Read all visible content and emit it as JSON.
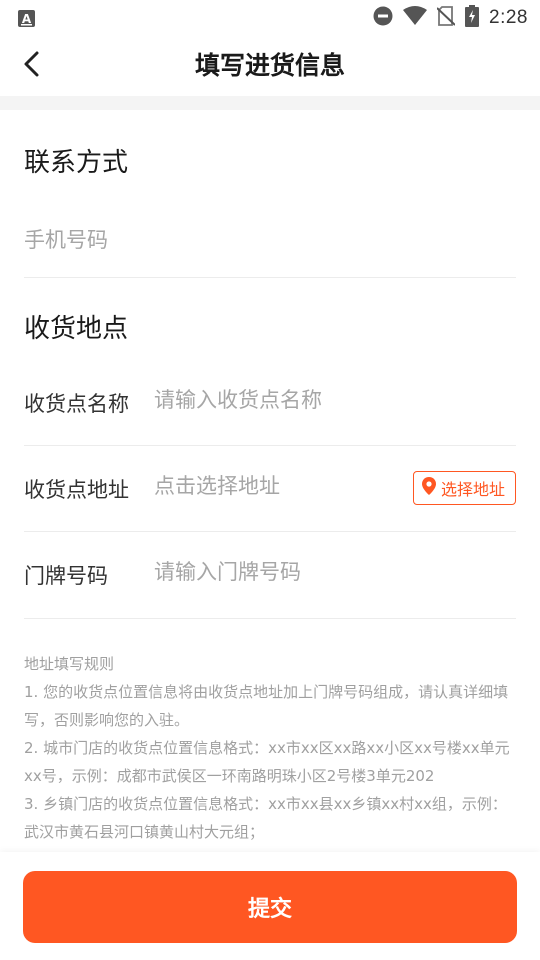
{
  "status_bar": {
    "left_icon": "a-letter-icon",
    "icons": [
      "do-not-disturb-icon",
      "wifi-icon",
      "no-sim-icon",
      "battery-charging-icon"
    ],
    "time": "2:28"
  },
  "header": {
    "back_icon": "chevron-left-icon",
    "title": "填写进货信息"
  },
  "contact_section": {
    "title": "联系方式",
    "phone_placeholder": "手机号码"
  },
  "location_section": {
    "title": "收货地点",
    "name_label": "收货点名称",
    "name_placeholder": "请输入收货点名称",
    "address_label": "收货点地址",
    "address_placeholder": "点击选择地址",
    "select_address_label": "选择地址",
    "select_address_icon": "location-pin-icon",
    "door_label": "门牌号码",
    "door_placeholder": "请输入门牌号码"
  },
  "rules": {
    "title": "地址填写规则",
    "line1": "1. 您的收货点位置信息将由收货点地址加上门牌号码组成，请认真详细填写，否则影响您的入驻。",
    "line2": "2. 城市门店的收货点位置信息格式：xx市xx区xx路xx小区xx号楼xx单元xx号，示例：成都市武侯区一环南路明珠小区2号楼3单元202",
    "line3": "3. 乡镇门店的收货点位置信息格式：xx市xx县xx乡镇xx村xx组，示例：武汉市黄石县河口镇黄山村大元组；"
  },
  "footer": {
    "submit_label": "提交"
  },
  "colors": {
    "accent": "#ff5722",
    "placeholder": "#a6a6a6",
    "divider": "#ececec"
  }
}
